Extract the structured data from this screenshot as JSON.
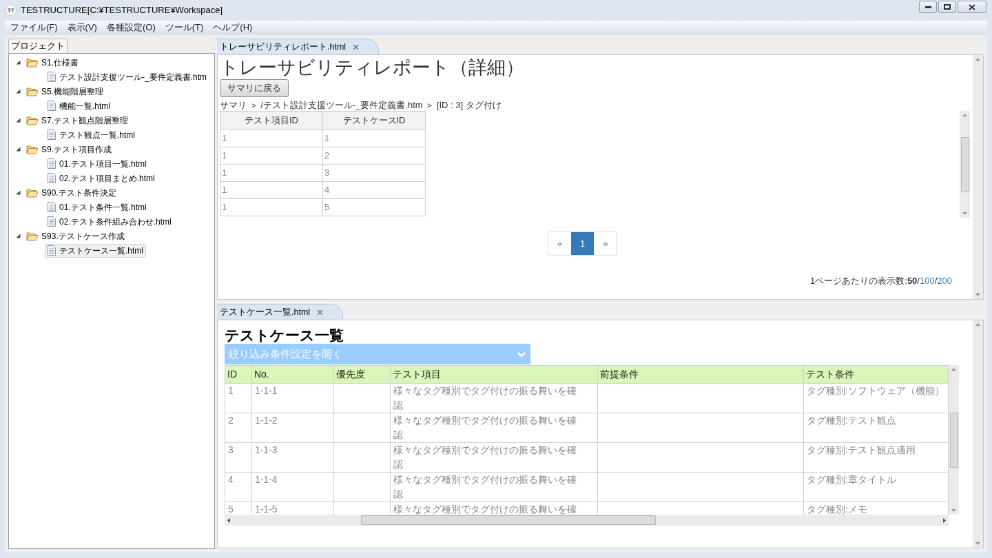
{
  "window": {
    "title": "TESTRUCTURE[C:¥TESTRUCTURE¥Workspace]"
  },
  "menu": [
    "ファイル(F)",
    "表示(V)",
    "各種設定(O)",
    "ツール(T)",
    "ヘルプ(H)"
  ],
  "project_panel": {
    "tab": "プロジェクト",
    "tree": [
      {
        "label": "S1.仕様書",
        "kind": "folder",
        "expanded": true,
        "selected": false,
        "children": [
          {
            "label": "テスト設計支援ツール-_要件定義書.htm",
            "kind": "file",
            "selected": false
          }
        ]
      },
      {
        "label": "S5.機能階層整理",
        "kind": "folder",
        "expanded": true,
        "selected": false,
        "children": [
          {
            "label": "機能一覧.html",
            "kind": "file",
            "selected": false
          }
        ]
      },
      {
        "label": "S7.テスト観点階層整理",
        "kind": "folder",
        "expanded": true,
        "selected": false,
        "children": [
          {
            "label": "テスト観点一覧.html",
            "kind": "file",
            "selected": false
          }
        ]
      },
      {
        "label": "S9.テスト項目作成",
        "kind": "folder",
        "expanded": true,
        "selected": false,
        "children": [
          {
            "label": "01.テスト項目一覧.html",
            "kind": "file",
            "selected": false
          },
          {
            "label": "02.テスト項目まとめ.html",
            "kind": "file",
            "selected": false
          }
        ]
      },
      {
        "label": "S90.テスト条件決定",
        "kind": "folder",
        "expanded": true,
        "selected": false,
        "children": [
          {
            "label": "01.テスト条件一覧.html",
            "kind": "file",
            "selected": false
          },
          {
            "label": "02.テスト条件組み合わせ.html",
            "kind": "file",
            "selected": false
          }
        ]
      },
      {
        "label": "S93.テストケース作成",
        "kind": "folder",
        "expanded": true,
        "selected": false,
        "children": [
          {
            "label": "テストケース一覧.html",
            "kind": "file",
            "selected": true
          }
        ]
      }
    ]
  },
  "top_editor": {
    "tab": "トレーサビリティレポート.html",
    "title": "トレーサビリティレポート（詳細）",
    "back_button": "サマリに戻る",
    "breadcrumb": "サマリ ＞ /テスト設計支援ツール-_要件定義書.htm ＞ [ID : 3] タグ付け",
    "table": {
      "columns": [
        "テスト項目ID",
        "テストケースID"
      ],
      "rows": [
        [
          "1",
          "1"
        ],
        [
          "1",
          "2"
        ],
        [
          "1",
          "3"
        ],
        [
          "1",
          "4"
        ],
        [
          "1",
          "5"
        ]
      ]
    },
    "pagination": [
      {
        "label": "«",
        "selected": false
      },
      {
        "label": "1",
        "selected": true
      },
      {
        "label": "»",
        "selected": false
      }
    ],
    "per_page": {
      "label": "1ページあたりの表示数:",
      "separator": "/",
      "options": [
        {
          "label": "50",
          "selected": true
        },
        {
          "label": "100",
          "selected": false
        },
        {
          "label": "200",
          "selected": false
        }
      ]
    }
  },
  "bottom_editor": {
    "tab": "テストケース一覧.html",
    "title": "テストケース一覧",
    "filter_toggle": "絞り込み条件設定を開く",
    "table": {
      "columns": [
        "ID",
        "No.",
        "優先度",
        "テスト項目",
        "前提条件",
        "テスト条件"
      ],
      "rows": [
        [
          "1",
          "1-1-1",
          "",
          "様々なタグ種別でタグ付けの振る舞いを確認",
          "",
          "タグ種別:ソフトウェア（機能）"
        ],
        [
          "2",
          "1-1-2",
          "",
          "様々なタグ種別でタグ付けの振る舞いを確認",
          "",
          "タグ種別:テスト観点"
        ],
        [
          "3",
          "1-1-3",
          "",
          "様々なタグ種別でタグ付けの振る舞いを確認",
          "",
          "タグ種別:テスト観点適用"
        ],
        [
          "4",
          "1-1-4",
          "",
          "様々なタグ種別でタグ付けの振る舞いを確認",
          "",
          "タグ種別:章タイトル"
        ],
        [
          "5",
          "1-1-5",
          "",
          "様々なタグ種別でタグ付けの振る舞いを確",
          "",
          "タグ種別:メモ"
        ]
      ]
    }
  }
}
